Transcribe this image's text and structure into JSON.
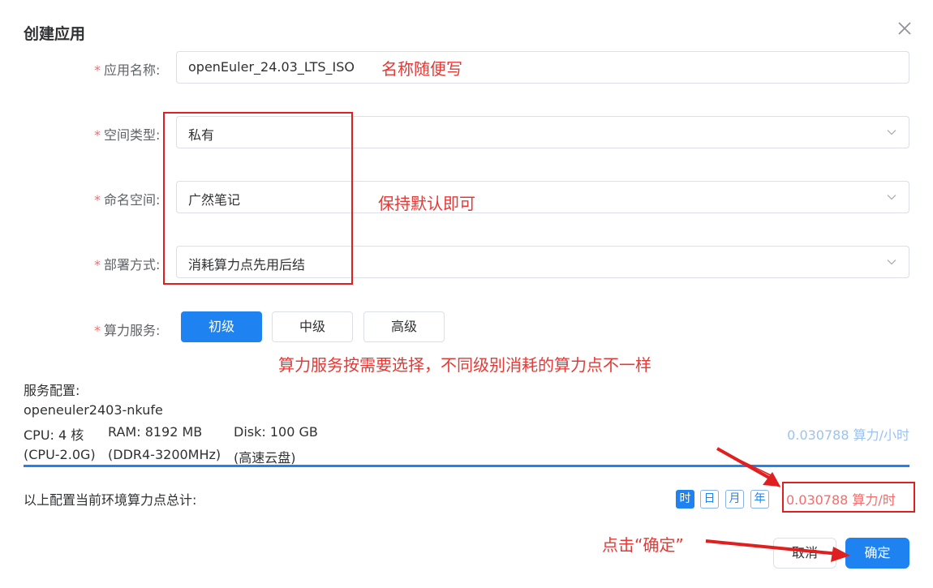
{
  "dialog": {
    "title": "创建应用"
  },
  "form": {
    "app_name": {
      "label": "应用名称:",
      "value": "openEuler_24.03_LTS_ISO"
    },
    "space_type": {
      "label": "空间类型:",
      "value": "私有"
    },
    "namespace": {
      "label": "命名空间:",
      "value": "广然笔记"
    },
    "deploy_mode": {
      "label": "部署方式:",
      "value": "消耗算力点先用后结"
    },
    "compute_service": {
      "label": "算力服务:",
      "options": [
        "初级",
        "中级",
        "高级"
      ],
      "selected": "初级"
    }
  },
  "service_config": {
    "heading": "服务配置:",
    "name": "openeuler2403-nkufe",
    "cpu": "CPU: 4 核",
    "ram": "RAM: 8192 MB",
    "disk": "Disk: 100 GB",
    "cpu_detail": "(CPU-2.0G)",
    "ram_detail": "(DDR4-3200MHz)",
    "disk_detail": "(高速云盘)",
    "rate": "0.030788 算力/小时"
  },
  "summary": {
    "label": "以上配置当前环境算力点总计:",
    "periods": [
      "时",
      "日",
      "月",
      "年"
    ],
    "selected_period": "时",
    "total": "0.030788 算力/时"
  },
  "footer": {
    "cancel_label": "取消",
    "confirm_label": "确定"
  },
  "annotations": {
    "name_note": "名称随便写",
    "default_note": "保持默认即可",
    "service_note": "算力服务按需要选择，不同级别消耗的算力点不一样",
    "click_note": "点击“确定”"
  },
  "colors": {
    "primary": "#1e83f0",
    "annotation_red": "#e53935",
    "required_star": "#f56c6c",
    "rate_faded": "#9cc3ef",
    "total_red": "#f56c6c"
  }
}
